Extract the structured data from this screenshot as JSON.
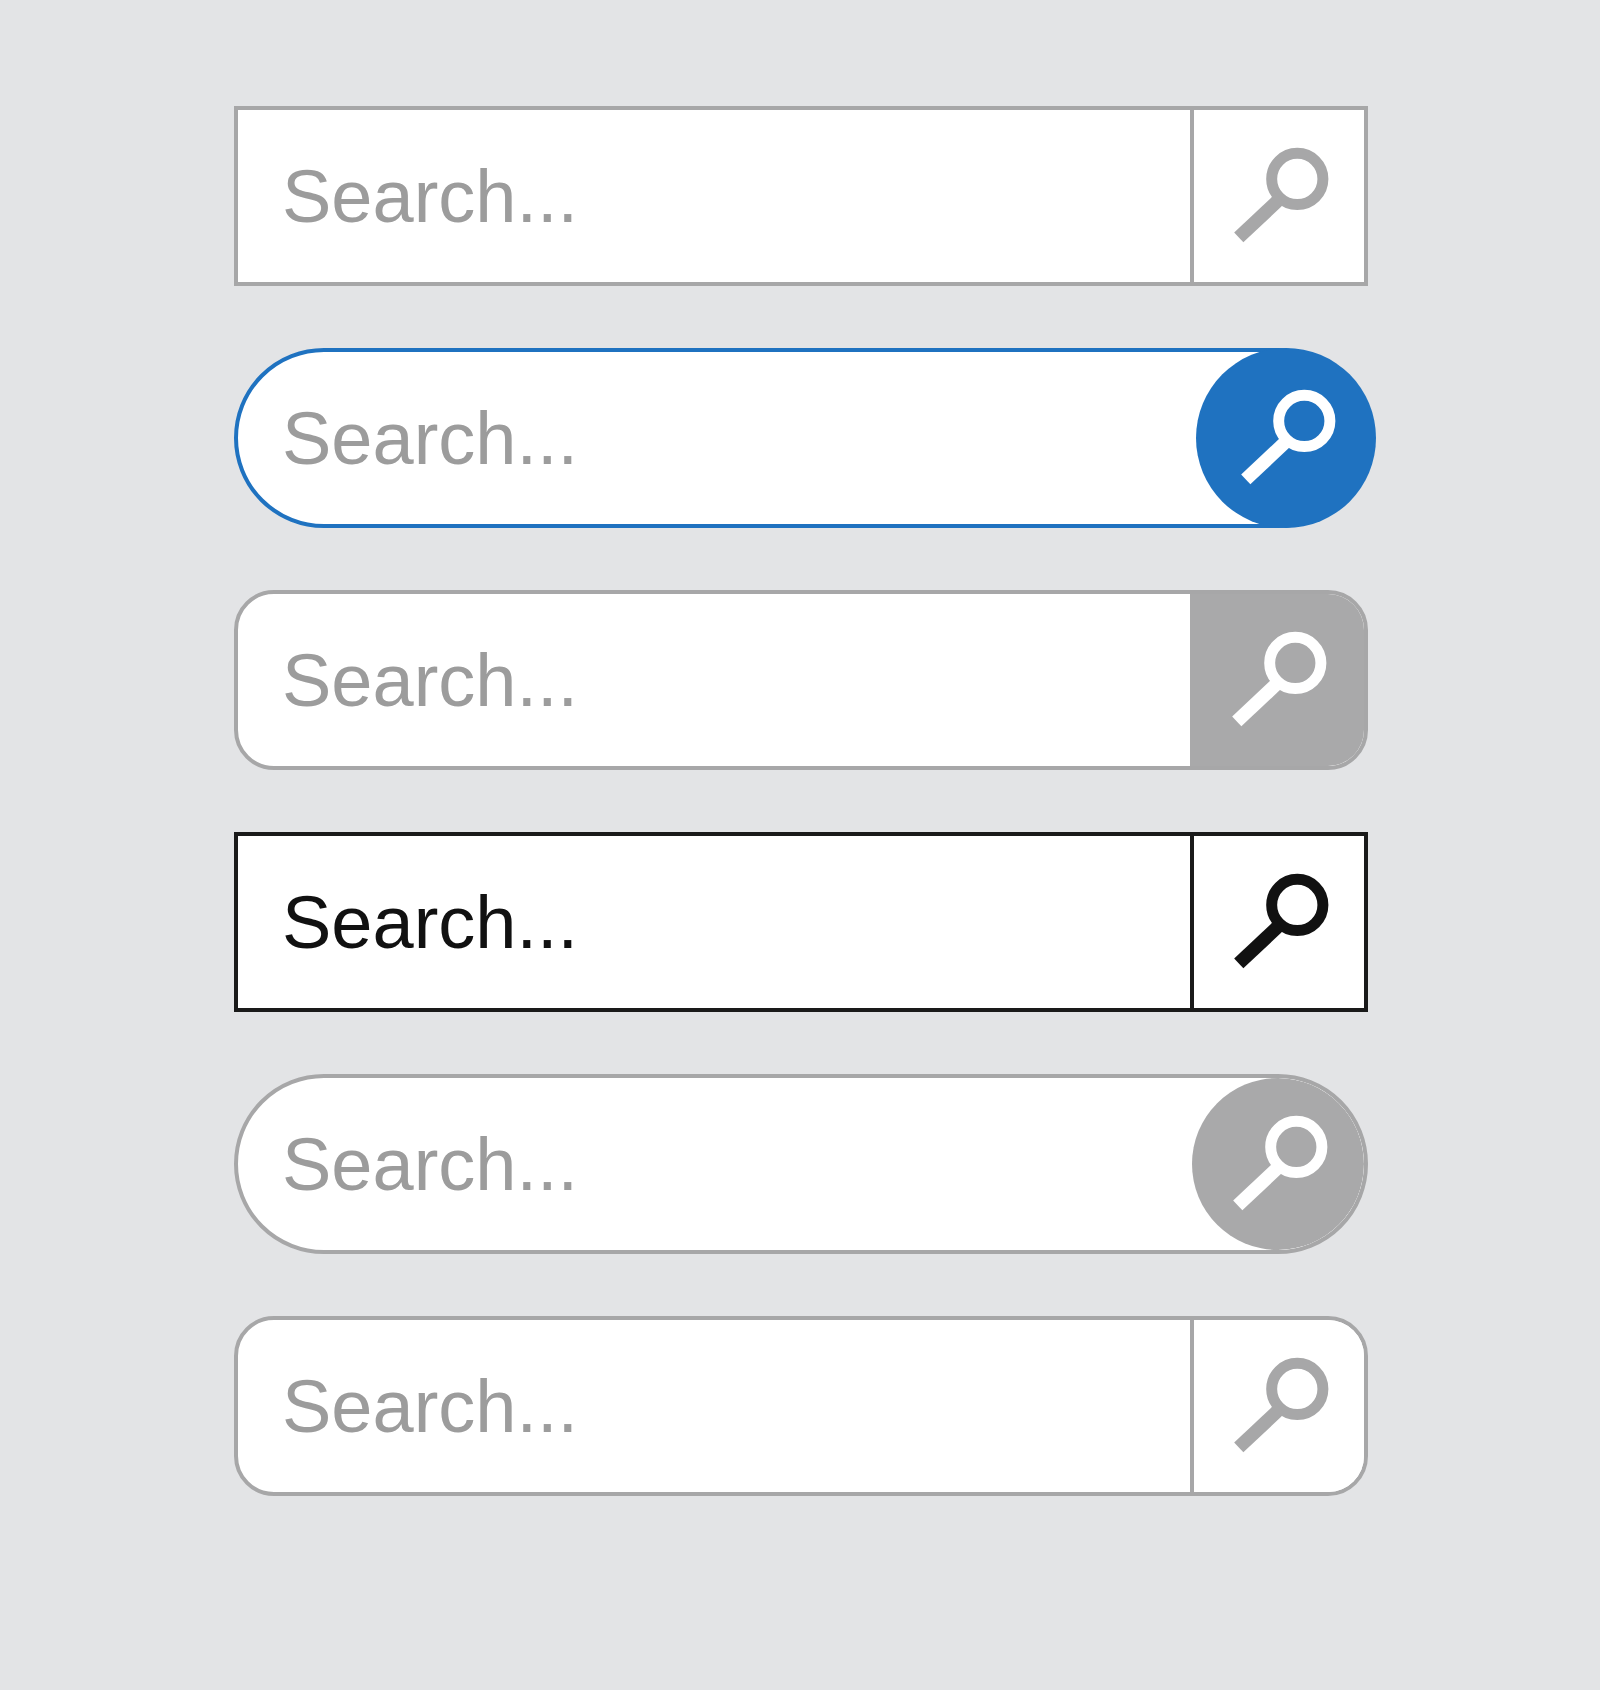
{
  "search_bars": [
    {
      "kind": "square-grey",
      "placeholder": "Search..."
    },
    {
      "kind": "pill-blue",
      "placeholder": "Search..."
    },
    {
      "kind": "rounded-filled",
      "placeholder": "Search..."
    },
    {
      "kind": "square-black",
      "placeholder": "Search..."
    },
    {
      "kind": "pill-circle",
      "placeholder": "Search..."
    },
    {
      "kind": "rounded-outline",
      "placeholder": "Search..."
    }
  ]
}
